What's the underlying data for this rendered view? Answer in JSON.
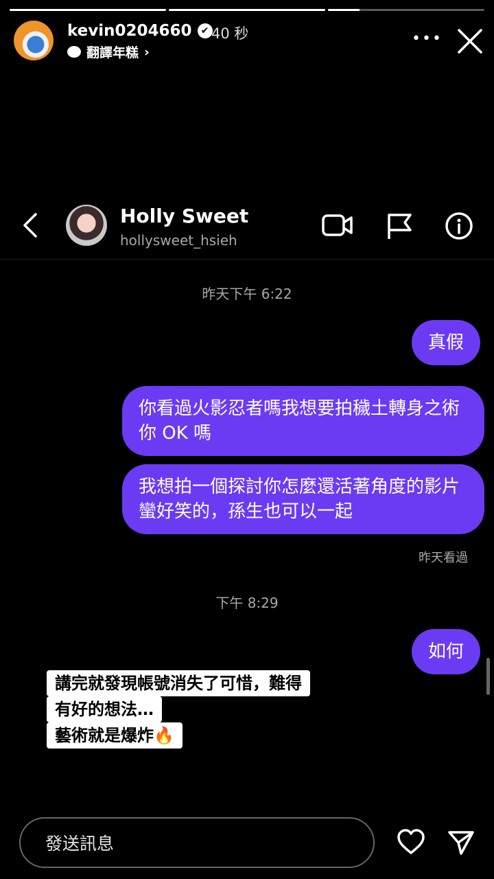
{
  "story": {
    "progress": [
      1.0,
      1.0,
      0.2
    ],
    "username": "kevin0204660",
    "verified_mark": "✔",
    "time_ago": "40 秒",
    "subtitle": "翻譯年糕",
    "subtitle_chevron": "›",
    "more": "•••",
    "icons": [
      "avatar",
      "verified-icon",
      "chat-bubble-icon",
      "more-icon",
      "close-icon"
    ]
  },
  "chat": {
    "name": "Holly Sweet",
    "handle": "hollysweet_hsieh",
    "icons": [
      "back-icon",
      "video-call-icon",
      "flag-icon",
      "info-icon"
    ]
  },
  "messages": [
    {
      "type": "timestamp",
      "text": "昨天下午 6:22"
    },
    {
      "type": "sent",
      "text": "真假"
    },
    {
      "type": "sent",
      "text": "你看過火影忍者嗎我想要拍穢土轉身之術你 OK 嗎"
    },
    {
      "type": "sent",
      "text": "我想拍一個探討你怎麼還活著角度的影片蠻好笑的，孫生也可以一起"
    },
    {
      "type": "seen",
      "text": "昨天看過"
    },
    {
      "type": "timestamp",
      "text": "下午 8:29"
    },
    {
      "type": "sent",
      "text": "如何"
    }
  ],
  "caption": {
    "lines": [
      "講完就發現帳號消失了可惜，難得",
      "有好的想法…",
      "藝術就是爆炸🔥"
    ]
  },
  "composer": {
    "placeholder": "發送訊息",
    "icons": [
      "heart-icon",
      "send-icon"
    ]
  },
  "colors": {
    "accent": "#6a3bf3",
    "background": "#000000",
    "caption_bg": "#ffffff"
  }
}
